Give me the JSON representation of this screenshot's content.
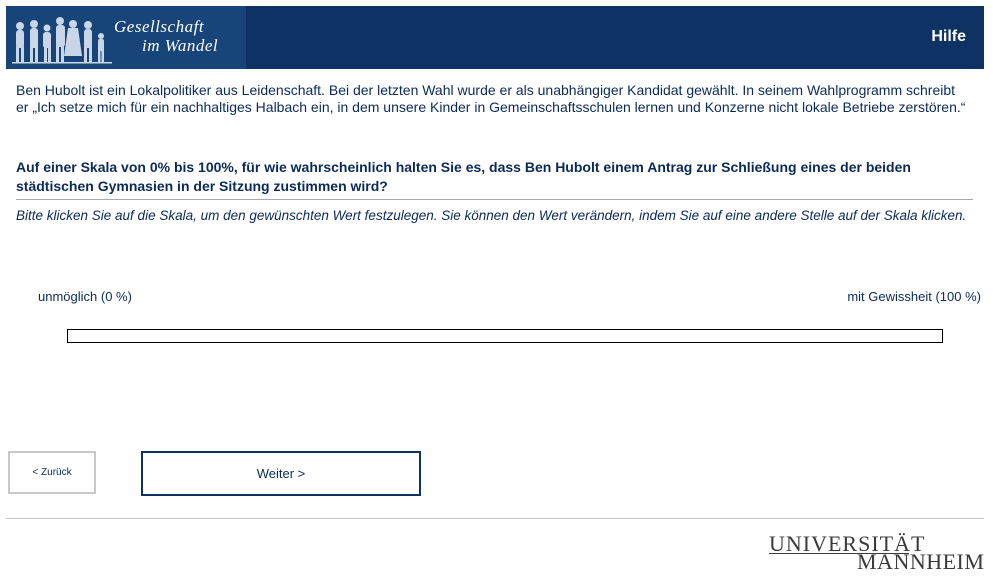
{
  "header": {
    "logo_line1": "Gesellschaft",
    "logo_line2": "im Wandel",
    "help_label": "Hilfe",
    "colors": {
      "bar": "#0e3264",
      "logo_bg": "#184579"
    }
  },
  "content": {
    "intro": "Ben Hubolt ist ein Lokalpolitiker aus Leidenschaft. Bei der letzten Wahl wurde er als unabhängiger Kandidat gewählt. In seinem Wahlprogramm schreibt er „Ich setze mich für ein nachhaltiges Halbach ein, in dem unsere Kinder in Gemeinschaftsschulen lernen und Konzerne nicht lokale Betriebe zerstören.“",
    "question": "Auf einer Skala von 0% bis 100%, für wie wahrscheinlich halten Sie es, dass Ben Hubolt einem Antrag zur Schließung eines der beiden städtischen Gymnasien in der Sitzung zustimmen wird?",
    "instruction": "Bitte klicken Sie auf die Skala, um den gewünschten Wert festzulegen. Sie können den Wert verändern, indem Sie auf eine andere Stelle auf der Skala klicken."
  },
  "scale": {
    "left_label": "unmöglich (0 %)",
    "right_label": "mit Gewissheit (100 %)"
  },
  "nav": {
    "back_label": "< Zurück",
    "next_label": "Weiter >"
  },
  "footer": {
    "uni_line1": "UNIVERSITÄT",
    "uni_line2": "MANNHEIM"
  }
}
